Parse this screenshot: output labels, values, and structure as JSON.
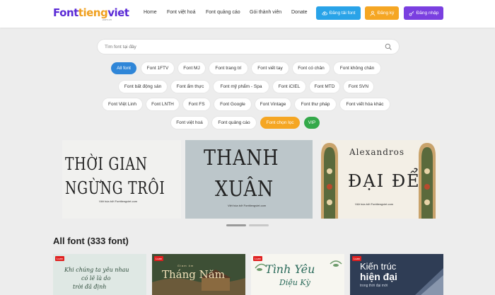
{
  "header": {
    "logo": {
      "part1": "Font",
      "part2": "tieng",
      "part3": "viet",
      "sub": ".com.vn"
    },
    "nav": [
      "Home",
      "Font việt hoá",
      "Font quảng cáo",
      "Gói thành viên",
      "Donate"
    ],
    "buttons": {
      "upload": "Đăng tải font",
      "register": "Đăng ký",
      "login": "Đăng nhập"
    }
  },
  "search": {
    "placeholder": "Tìm font tại đây"
  },
  "chips": {
    "row1": [
      "All font",
      "Font 1FTV",
      "Font MJ",
      "Font trang trí",
      "Font viết tay",
      "Font có chân",
      "Font không chân"
    ],
    "row2": [
      "Font bất động sản",
      "Font ẩm thực",
      "Font mỹ phẩm - Spa",
      "Font iCIEL",
      "Font MTD",
      "Font SVN"
    ],
    "row3": [
      "Font Việt Linh",
      "Font LNTH",
      "Font FS",
      "Font Google",
      "Font Vintage",
      "Font thư pháp",
      "Font viết hóa khác"
    ],
    "row4": [
      "Font việt hoá",
      "Font quảng cáo",
      "Font chọn lọc",
      "VIP"
    ]
  },
  "banners": {
    "left": {
      "line1": "THỜI GIAN",
      "line2": "NGỪNG TRÔI",
      "caption": "Việt hóa bởi Fonttiengviet.com"
    },
    "center": {
      "line1": "THANH",
      "line2": "XUÂN",
      "caption": "Việt hóa bởi Fonttiengviet.com"
    },
    "right": {
      "line1": "Alexandros",
      "line2": "ĐẠI ĐỂ",
      "caption": "Việt hóa bởi Fonttiengviet.com"
    }
  },
  "section": {
    "title": "All font (333 font)"
  },
  "cards": [
    {
      "tag": "Luan",
      "line1": "Khi chúng ta yêu nhau",
      "line2": "có lẽ là do",
      "line3": "trời đã định"
    },
    {
      "tag": "Luan",
      "line1": "Giam ôm",
      "line2": "Tháng Năm"
    },
    {
      "tag": "Luan",
      "line1": "Tình Yêu",
      "line2": "Diệu Kỳ"
    },
    {
      "tag": "Luan",
      "line1": "Kiến trúc",
      "line2": "hiện đại",
      "line3": "trong thời đại mới"
    }
  ],
  "colors": {
    "brand_purple": "#5b2bd6",
    "brand_orange": "#f0a020",
    "upload_btn": "#29a3e8",
    "register_btn": "#f5a623",
    "login_btn": "#7a3fe0",
    "chip_active": "#2f86d8",
    "chip_vip": "#34a94a"
  }
}
